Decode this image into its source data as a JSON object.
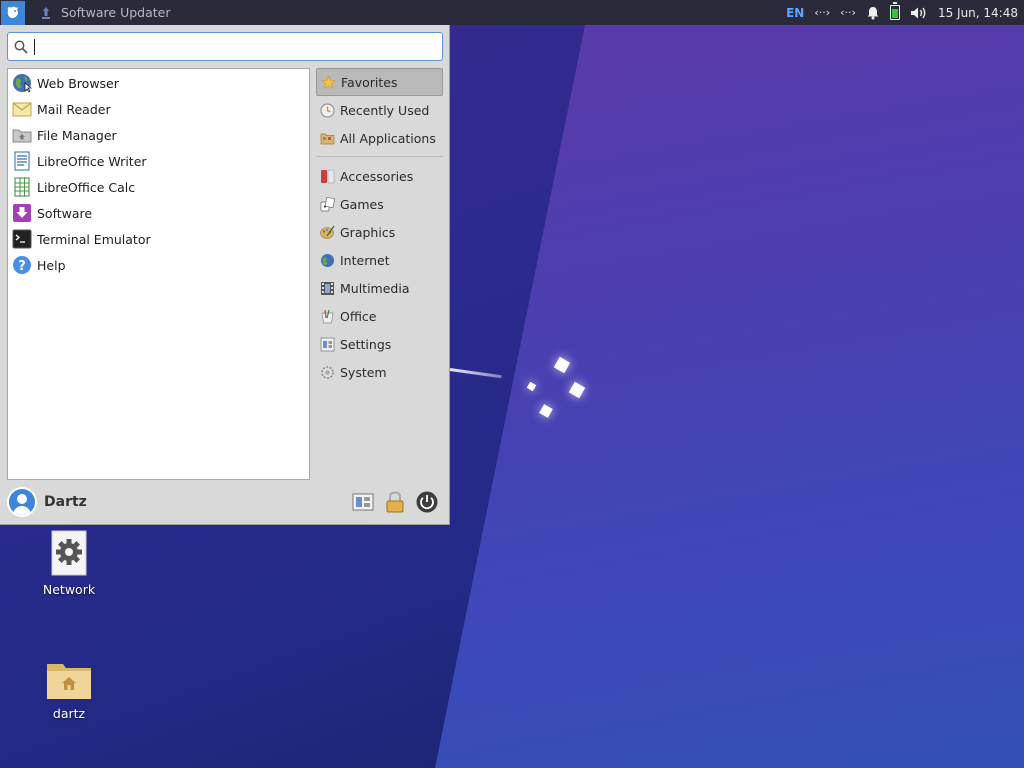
{
  "panel": {
    "task_title": "Software Updater",
    "lang": "EN",
    "clock": "15 Jun, 14:48",
    "tray_icons": [
      "network-wired-icon",
      "network-wired-icon",
      "notification-bell-icon",
      "battery-icon",
      "volume-icon"
    ]
  },
  "menu": {
    "search": {
      "value": "",
      "placeholder": ""
    },
    "apps": [
      {
        "label": "Web Browser",
        "icon": "web-browser-icon"
      },
      {
        "label": "Mail Reader",
        "icon": "mail-icon"
      },
      {
        "label": "File Manager",
        "icon": "file-manager-icon"
      },
      {
        "label": "LibreOffice Writer",
        "icon": "writer-icon"
      },
      {
        "label": "LibreOffice Calc",
        "icon": "calc-icon"
      },
      {
        "label": "Software",
        "icon": "software-icon"
      },
      {
        "label": "Terminal Emulator",
        "icon": "terminal-icon"
      },
      {
        "label": "Help",
        "icon": "help-icon"
      }
    ],
    "categories_top": [
      {
        "label": "Favorites",
        "icon": "star-icon",
        "active": true
      },
      {
        "label": "Recently Used",
        "icon": "clock-icon"
      },
      {
        "label": "All Applications",
        "icon": "folder-icon"
      }
    ],
    "categories": [
      {
        "label": "Accessories",
        "icon": "accessories-icon"
      },
      {
        "label": "Games",
        "icon": "games-icon"
      },
      {
        "label": "Graphics",
        "icon": "graphics-icon"
      },
      {
        "label": "Internet",
        "icon": "internet-icon"
      },
      {
        "label": "Multimedia",
        "icon": "multimedia-icon"
      },
      {
        "label": "Office",
        "icon": "office-icon"
      },
      {
        "label": "Settings",
        "icon": "settings-icon"
      },
      {
        "label": "System",
        "icon": "system-icon"
      }
    ],
    "user": {
      "name": "Dartz"
    }
  },
  "desktop": {
    "icons": [
      {
        "label": "Network",
        "icon": "network-settings-icon"
      },
      {
        "label": "dartz",
        "icon": "home-folder-icon"
      }
    ]
  },
  "colors": {
    "accent": "#3e86d8",
    "panel": "#2b2a3a",
    "menu_bg": "#d9d9d9"
  }
}
